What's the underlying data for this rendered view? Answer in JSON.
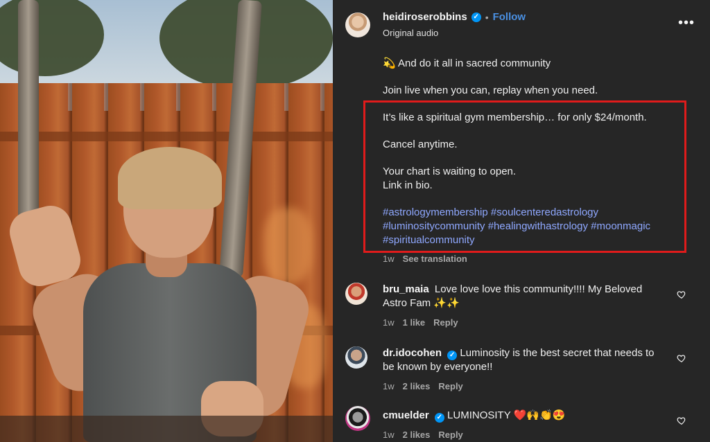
{
  "post": {
    "username": "heidiroserobbins",
    "follow_label": "Follow",
    "audio": "Original audio",
    "more_label": "•••",
    "caption": {
      "line1": "💫 And do it all in sacred community",
      "line2": "Join live when you can, replay when you need.",
      "line3": "It’s like a spiritual gym membership… for only $24/month.",
      "line4": "Cancel anytime.",
      "line5a": "Your chart is waiting to open.",
      "line5b": "Link in bio.",
      "hashtags": [
        "#astrologymembership",
        "#soulcenteredastrology",
        "#luminositycommunity",
        "#healingwithastrology",
        "#moonmagic",
        "#spiritualcommunity"
      ]
    },
    "time": "1w",
    "see_translation": "See translation"
  },
  "comments": [
    {
      "username": "bru_maia",
      "verified": false,
      "text": "Love love love this community!!!! My Beloved Astro Fam ✨✨",
      "time": "1w",
      "likes": "1 like",
      "reply": "Reply"
    },
    {
      "username": "dr.idocohen",
      "verified": true,
      "text": "Luminosity is the best secret that needs to be known by everyone!!",
      "time": "1w",
      "likes": "2 likes",
      "reply": "Reply"
    },
    {
      "username": "cmuelder",
      "verified": true,
      "text": "LUMINOSITY ❤️🙌👏😍",
      "time": "1w",
      "likes": "2 likes",
      "reply": "Reply"
    }
  ],
  "colors": {
    "panel_bg": "#262626",
    "link": "#8fa8ff",
    "follow": "#4a90e2",
    "highlight_box": "#e01b1b",
    "verified": "#0095f6"
  },
  "icons": {
    "verified": "verified-badge-icon",
    "heart": "heart-outline-icon",
    "more": "more-horizontal-icon"
  }
}
